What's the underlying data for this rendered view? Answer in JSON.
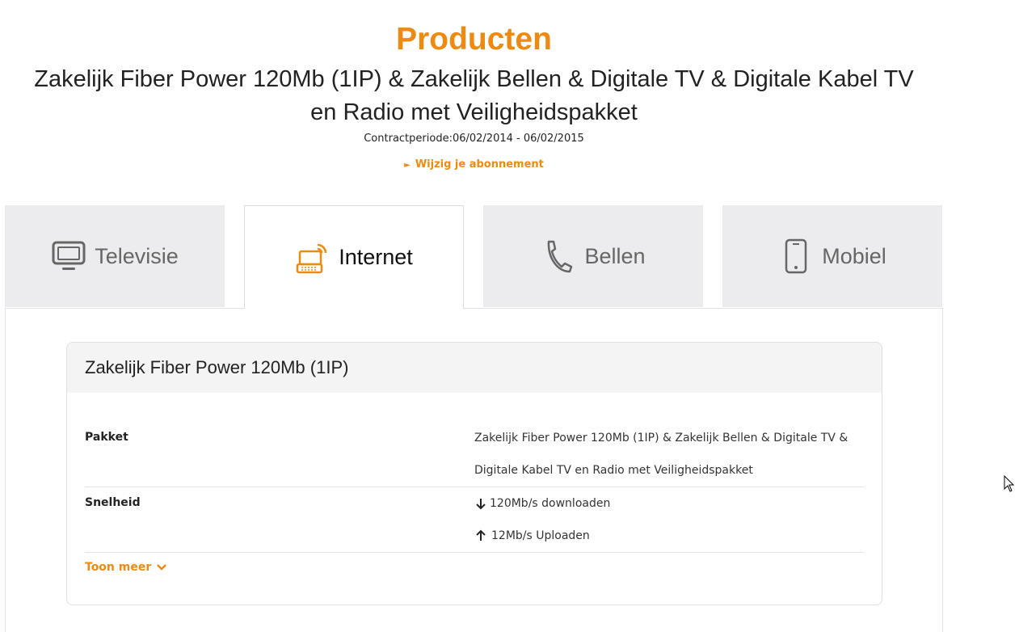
{
  "header": {
    "title": "Producten",
    "subtitle_line1": "Zakelijk Fiber Power 120Mb (1IP) & Zakelijk Bellen & Digitale TV & Digitale Kabel TV",
    "subtitle_line2": "en Radio met Veiligheidspakket",
    "contract_label": "Contractperiode:",
    "contract_period": "06/02/2014 - 06/02/2015",
    "change_link": "Wijzig je abonnement"
  },
  "tabs": [
    {
      "label": "Televisie",
      "icon": "tv-icon",
      "active": false
    },
    {
      "label": "Internet",
      "icon": "laptop-wifi-icon",
      "active": true
    },
    {
      "label": "Bellen",
      "icon": "phone-handset-icon",
      "active": false
    },
    {
      "label": "Mobiel",
      "icon": "mobile-phone-icon",
      "active": false
    }
  ],
  "card": {
    "title": "Zakelijk Fiber Power 120Mb (1IP)",
    "rows": [
      {
        "label": "Pakket",
        "value_line1": "Zakelijk Fiber Power 120Mb (1IP) & Zakelijk Bellen & Digitale TV &",
        "value_line2": "Digitale Kabel TV en Radio met Veiligheidspakket"
      },
      {
        "label": "Snelheid",
        "download": "120Mb/s downloaden",
        "upload": "12Mb/s Uploaden"
      }
    ],
    "more_link": "Toon meer"
  },
  "colors": {
    "accent": "#ee8a10",
    "tab_inactive_bg": "#ececee",
    "card_header_bg": "#f4f4f4"
  }
}
